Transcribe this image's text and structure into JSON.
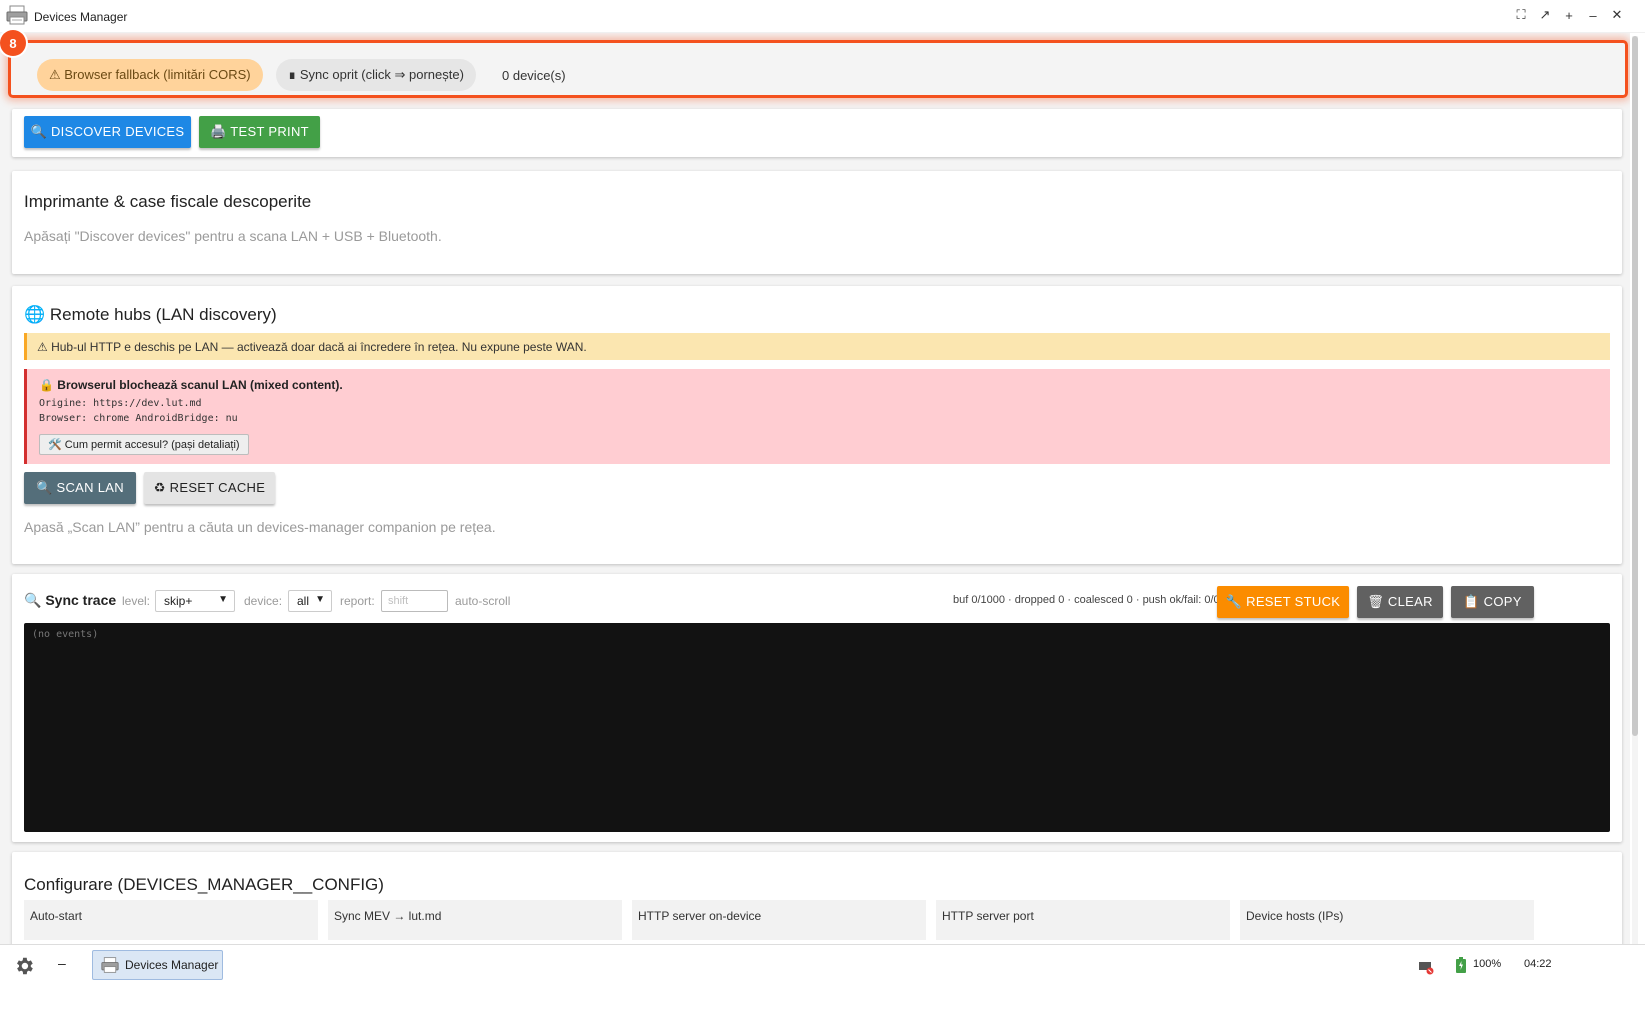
{
  "window": {
    "title": "Devices Manager",
    "controls": [
      "⛶",
      "↗",
      "+",
      "–",
      "✕"
    ]
  },
  "status": {
    "badge_number": "8",
    "fallback_label": "⚠ Browser fallback (limitări CORS)",
    "sync_label": "∎ Sync oprit (click ⇒ pornește)",
    "device_count": "0 device(s)",
    "highlight_color": "#f4511e"
  },
  "actions": {
    "discover_label": "🔍 DISCOVER DEVICES",
    "test_print_label": "🖨️ TEST PRINT"
  },
  "printers": {
    "title": "Imprimante & case fiscale descoperite",
    "hint": "Apăsați \"Discover devices\" pentru a scana LAN + USB + Bluetooth."
  },
  "hubs": {
    "title": "🌐 Remote hubs (LAN discovery)",
    "warning": "⚠ Hub-ul HTTP e deschis pe LAN — activează doar dacă ai încredere în rețea. Nu expune peste WAN.",
    "error_title": "🔒 Browserul blochează scanul LAN (mixed content).",
    "origin_line": "Origine: https://dev.lut.md",
    "browser_line": "Browser: chrome AndroidBridge: nu",
    "help_label": "🛠️ Cum permit accesul? (pași detaliați)",
    "scan_label": "🔍 SCAN LAN",
    "reset_cache_label": "♻ RESET CACHE",
    "hint": "Apasă „Scan LAN” pentru a căuta un devices-manager companion pe rețea."
  },
  "trace": {
    "title": "🔍 Sync trace",
    "level_label": "level:",
    "level_value": "skip+",
    "device_label": "device:",
    "device_value": "all",
    "report_label": "report:",
    "report_placeholder": "shift",
    "autoscroll_label": "auto-scroll",
    "stats": "buf 0/1000 · dropped 0 · coalesced 0 · push ok/fail: 0/0",
    "reset_stuck_label": "🔧 RESET STUCK",
    "clear_label": "🗑 CLEAR",
    "copy_label": "📋 COPY",
    "console_text": "(no events)"
  },
  "config": {
    "title": "Configurare (DEVICES_MANAGER__CONFIG)",
    "fields": [
      "Auto-start",
      "Sync MEV → lut.md",
      "HTTP server on-device",
      "HTTP server port",
      "Device hosts (IPs)"
    ]
  },
  "taskbar": {
    "app_label": "Devices Manager",
    "min_glyph": "–",
    "battery": "100%",
    "time": "04:22"
  }
}
